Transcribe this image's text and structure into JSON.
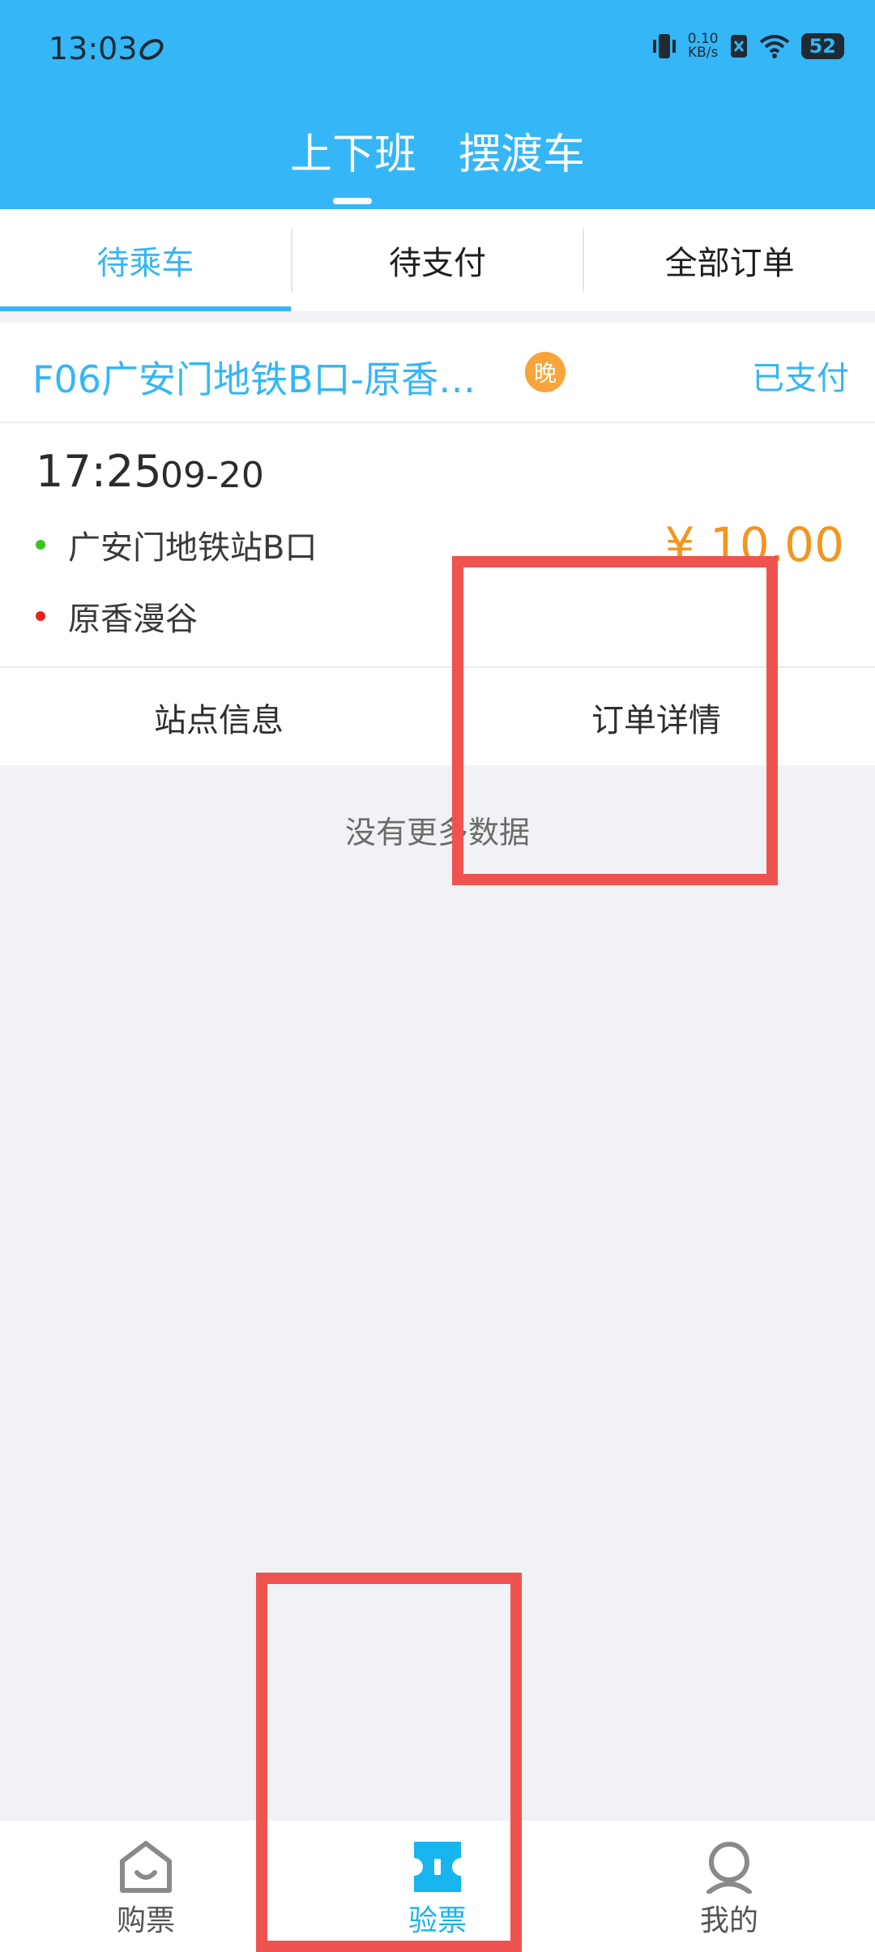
{
  "status_bar": {
    "time": "13:03",
    "net_speed_value": "0.10",
    "net_speed_unit": "KB/s",
    "battery": "52"
  },
  "header": {
    "tabs": [
      {
        "label": "上下班",
        "active": true
      },
      {
        "label": "摆渡车",
        "active": false
      }
    ]
  },
  "order_tabs": [
    {
      "label": "待乘车",
      "active": true
    },
    {
      "label": "待支付",
      "active": false
    },
    {
      "label": "全部订单",
      "active": false
    }
  ],
  "order": {
    "route": "F06广安门地铁B口-原香…",
    "badge": "晚",
    "status": "已支付",
    "time": "17:25",
    "date": "09-20",
    "start_stop": "广安门地铁站B口",
    "end_stop": "原香漫谷",
    "price": "¥ 10.00",
    "actions": {
      "station_info": "站点信息",
      "order_detail": "订单详情"
    }
  },
  "list_footer": "没有更多数据",
  "bottom_nav": [
    {
      "label": "购票",
      "icon": "home-icon",
      "active": false
    },
    {
      "label": "验票",
      "icon": "ticket-icon",
      "active": true
    },
    {
      "label": "我的",
      "icon": "profile-icon",
      "active": false
    }
  ],
  "colors": {
    "primary": "#35b6f6",
    "price": "#f2961f",
    "badge": "#f7a43a",
    "annotation": "#ef5350"
  }
}
